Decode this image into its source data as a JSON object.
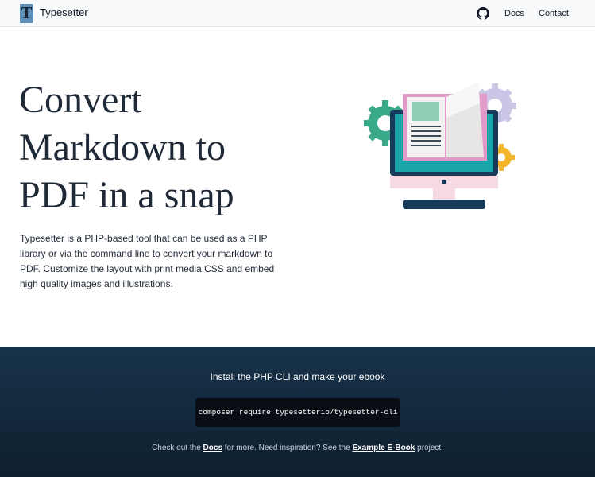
{
  "nav": {
    "brand_logo_letter": "T",
    "brand": "Typesetter",
    "github_icon": "github-icon",
    "docs": "Docs",
    "contact": "Contact"
  },
  "hero": {
    "title_lines": [
      "Convert",
      "Markdown to",
      "PDF in a snap"
    ],
    "description": "Typesetter is a PHP-based tool that can be used as a PHP library or via the command line to convert your markdown to PDF. Customize the layout with print media CSS and embed high quality images and illustrations.",
    "illustration_icon": "computer-book-illustration"
  },
  "footer": {
    "install_text": "Install the PHP CLI and make your ebook",
    "command": "composer require typesetterio/typesetter-cli",
    "more": {
      "prefix": "Check out the ",
      "docs_link": "Docs",
      "middle": " for more. Need inspiration? See the ",
      "example_link": "Example E-Book",
      "suffix": " project."
    }
  },
  "colors": {
    "nav_bg": "#f8f9fa",
    "footer_bg": "#152c40",
    "code_bg": "#080e14",
    "screen_teal": "#19a5a8",
    "book_pink": "#e29ac9",
    "gear_teal": "#3aa98a",
    "gear_lavender": "#c9c6e6",
    "gear_yellow": "#f3b62a",
    "monitor_dark": "#173a5b"
  }
}
